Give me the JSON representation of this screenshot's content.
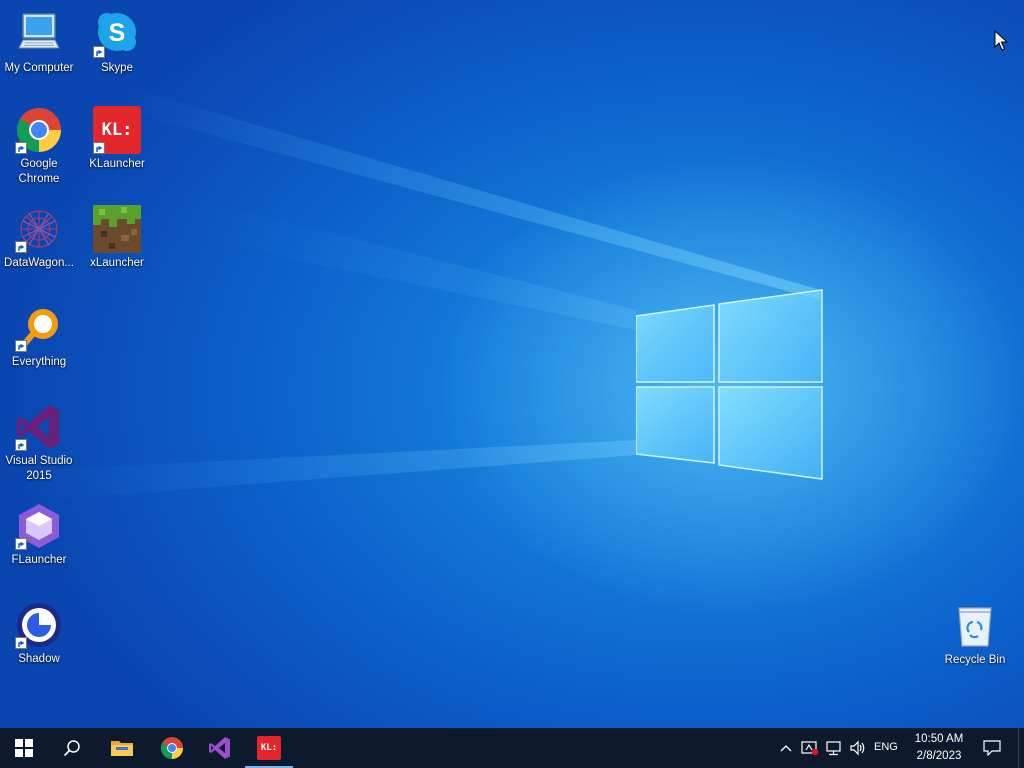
{
  "desktop": {
    "icons": [
      {
        "label": "My Computer",
        "icon": "computer-icon",
        "shortcut": false
      },
      {
        "label": "Skype",
        "icon": "skype-icon",
        "shortcut": true
      },
      {
        "label": "Google Chrome",
        "icon": "chrome-icon",
        "shortcut": true
      },
      {
        "label": "KLauncher",
        "icon": "klauncher-icon",
        "shortcut": true,
        "badge": "KL:"
      },
      {
        "label": "DataWagon...",
        "icon": "datawagon-icon",
        "shortcut": true
      },
      {
        "label": "xLauncher",
        "icon": "xlauncher-icon",
        "shortcut": true
      },
      {
        "label": "Everything",
        "icon": "everything-icon",
        "shortcut": true
      },
      {
        "label": "Visual Studio 2015",
        "icon": "visual-studio-icon",
        "shortcut": true
      },
      {
        "label": "FLauncher",
        "icon": "flauncher-icon",
        "shortcut": true
      },
      {
        "label": "Shadow",
        "icon": "shadow-icon",
        "shortcut": true
      },
      {
        "label": "Recycle Bin",
        "icon": "recycle-bin-icon",
        "shortcut": false
      }
    ]
  },
  "taskbar": {
    "pinned": [
      {
        "name": "start",
        "icon": "windows-start-icon"
      },
      {
        "name": "search",
        "icon": "search-icon"
      },
      {
        "name": "file-explorer",
        "icon": "folder-icon"
      },
      {
        "name": "chrome",
        "icon": "chrome-icon"
      },
      {
        "name": "visual-studio",
        "icon": "visual-studio-icon"
      },
      {
        "name": "klauncher",
        "icon": "klauncher-icon",
        "active": true,
        "badge": "KL:"
      }
    ],
    "tray": {
      "language": "ENG",
      "time": "10:50 AM",
      "date": "2/8/2023"
    }
  },
  "colors": {
    "taskbar_bg": "#0d1a2d",
    "wallpaper": "#127ad8",
    "klauncher_red": "#e3262b",
    "vs_purple": "#68217a"
  }
}
